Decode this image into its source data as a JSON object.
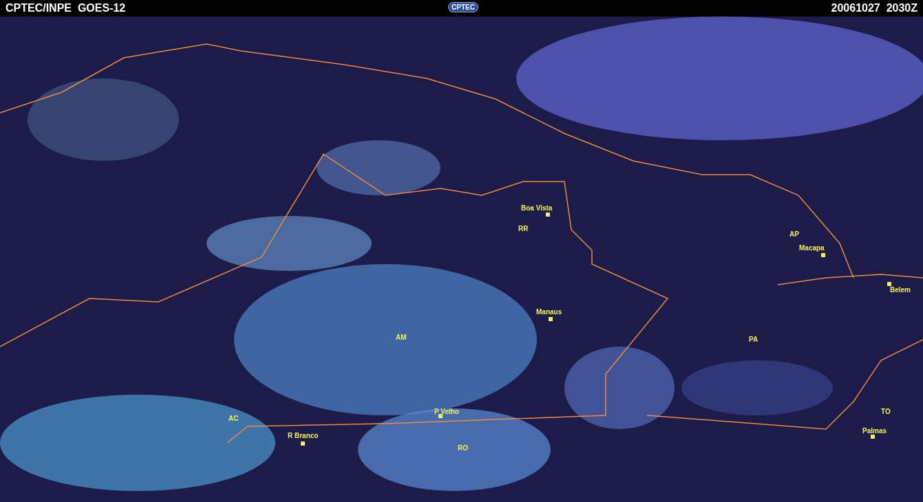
{
  "header": {
    "title": "CPTEC/INPE  GOES-12",
    "logo": "CPTEC",
    "timestamp": "20061027  2030Z"
  },
  "map": {
    "labels": [
      {
        "kind": "city",
        "text": "Boa Vista"
      },
      {
        "kind": "state",
        "text": "RR"
      },
      {
        "kind": "state",
        "text": "AP"
      },
      {
        "kind": "city",
        "text": "Macapa"
      },
      {
        "kind": "city",
        "text": "Belem"
      },
      {
        "kind": "city",
        "text": "Manaus"
      },
      {
        "kind": "state",
        "text": "AM"
      },
      {
        "kind": "state",
        "text": "PA"
      },
      {
        "kind": "state",
        "text": "AC"
      },
      {
        "kind": "city",
        "text": "P Velho"
      },
      {
        "kind": "city",
        "text": "R Branco"
      },
      {
        "kind": "state",
        "text": "RO"
      },
      {
        "kind": "state",
        "text": "TO"
      },
      {
        "kind": "city",
        "text": "Palmas"
      }
    ]
  }
}
